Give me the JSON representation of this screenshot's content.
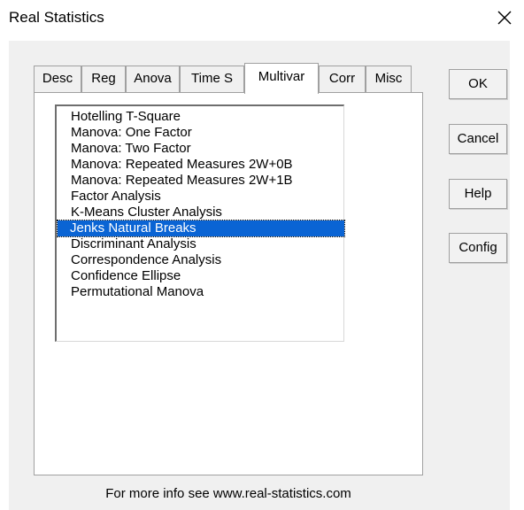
{
  "window": {
    "title": "Real Statistics",
    "close_glyph": "✕"
  },
  "tabs": [
    {
      "label": "Desc"
    },
    {
      "label": "Reg"
    },
    {
      "label": "Anova"
    },
    {
      "label": "Time S"
    },
    {
      "label": "Multivar",
      "active": true
    },
    {
      "label": "Corr"
    },
    {
      "label": "Misc"
    }
  ],
  "list": {
    "items": [
      "Hotelling T-Square",
      "Manova: One Factor",
      "Manova: Two Factor",
      "Manova: Repeated Measures 2W+0B",
      "Manova: Repeated Measures 2W+1B",
      "Factor Analysis",
      "K-Means Cluster Analysis",
      "Jenks Natural Breaks",
      "Discriminant Analysis",
      "Correspondence Analysis",
      "Confidence Ellipse",
      "Permutational Manova"
    ],
    "selected": "Jenks Natural Breaks"
  },
  "buttons": {
    "ok": "OK",
    "cancel": "Cancel",
    "help": "Help",
    "config": "Config"
  },
  "footer": {
    "text": "For more info see www.real-statistics.com"
  },
  "colors": {
    "selection": "#0a64d4",
    "panel": "#f0f0f0"
  }
}
